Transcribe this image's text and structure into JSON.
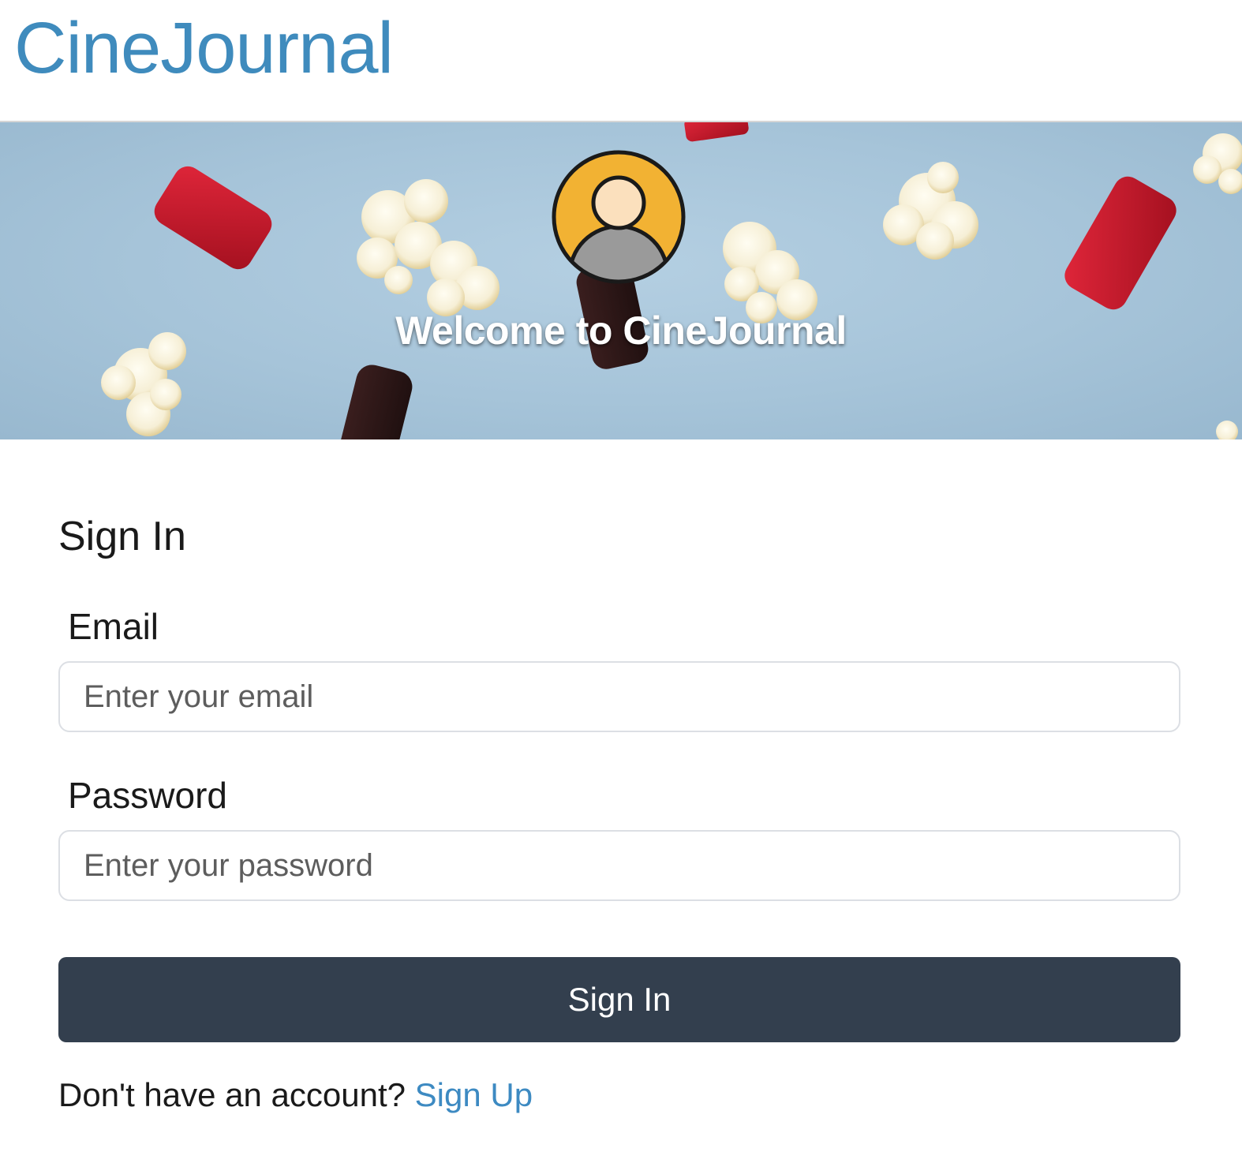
{
  "header": {
    "logo_text": "CineJournal",
    "logo_color": "#3f8bbd"
  },
  "hero": {
    "title": "Welcome to CineJournal",
    "avatar_icon": "user-avatar-icon",
    "background_color": "#a6c4d9",
    "avatar_ring_color": "#f2b233"
  },
  "form": {
    "title": "Sign In",
    "email_label": "Email",
    "email_placeholder": "Enter your email",
    "password_label": "Password",
    "password_placeholder": "Enter your password",
    "submit_label": "Sign In",
    "submit_color": "#333f4e",
    "signup_prompt": "Don't have an account?",
    "signup_link": "Sign Up",
    "link_color": "#3d8ac2"
  }
}
